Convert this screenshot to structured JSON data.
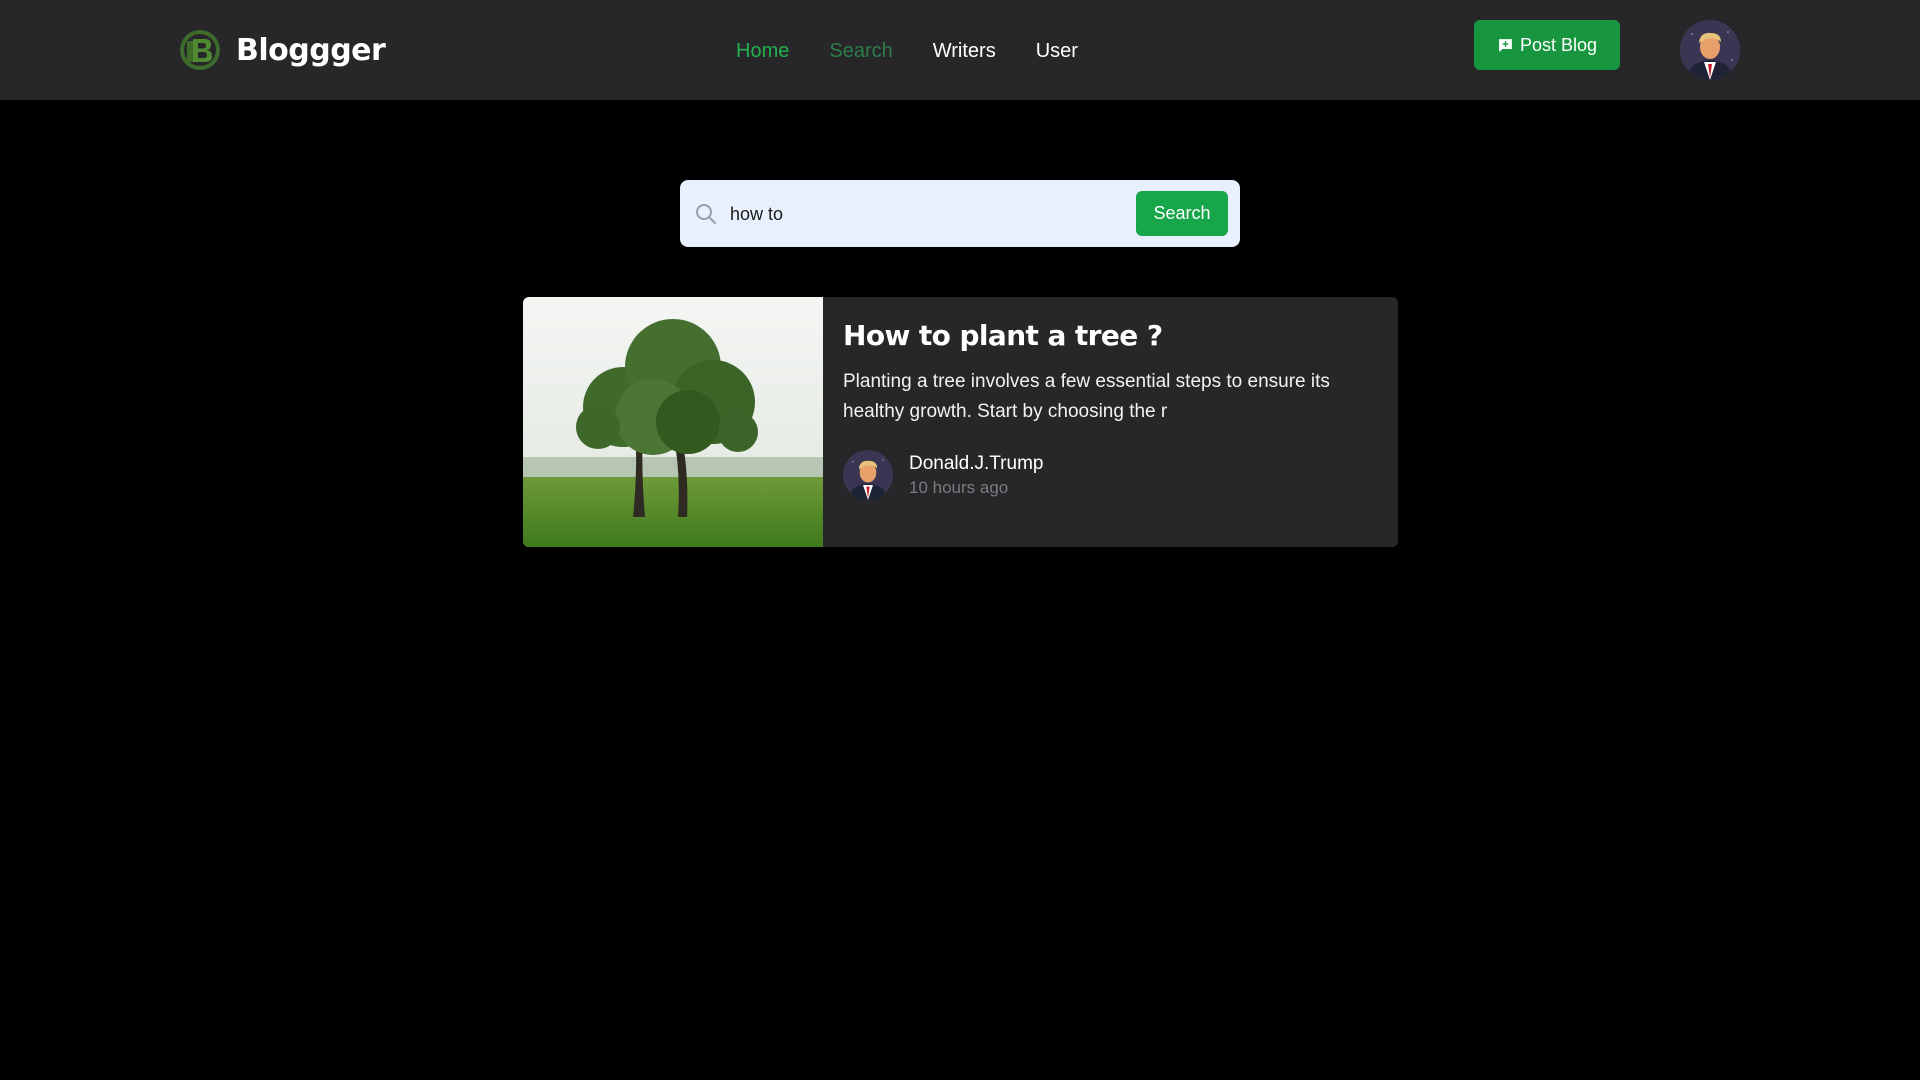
{
  "header": {
    "brand": "Bloggger",
    "nav": [
      {
        "label": "Home",
        "state": "active"
      },
      {
        "label": "Search",
        "state": "current"
      },
      {
        "label": "Writers",
        "state": "default"
      },
      {
        "label": "User",
        "state": "default"
      }
    ],
    "post_button": "Post Blog",
    "post_button_icon": "message-plus-icon",
    "avatar_icon": "user-avatar"
  },
  "search": {
    "value": "how to",
    "button": "Search",
    "icon": "search-icon"
  },
  "results": [
    {
      "title": "How to plant a tree ?",
      "excerpt": "Planting a tree involves a few essential steps to ensure its healthy growth. Start by choosing the r",
      "author": "Donald.J.Trump",
      "time": "10 hours ago"
    }
  ],
  "colors": {
    "background": "#000000",
    "header": "#272729",
    "card": "#272729",
    "accent": "#17a64a",
    "nav_active": "#22b14c",
    "muted_text": "#7b7b80",
    "search_bg": "#e8f0fd"
  }
}
